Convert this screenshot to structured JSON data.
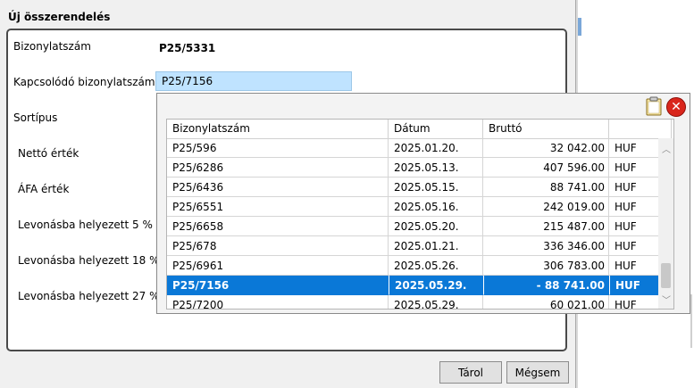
{
  "window": {
    "title": "Új összerendelés"
  },
  "form": {
    "doc_number_label": "Bizonylatszám",
    "doc_number_value": "P25/5331",
    "related_doc_label": "Kapcsolódó bizonylatszám",
    "related_doc_value": "P25/7156",
    "sort_type_label": "Sortípus",
    "net_value_label": "Nettó érték",
    "vat_value_label": "ÁFA érték",
    "deducted_5_label": "Levonásba helyezett 5 %",
    "deducted_18_label": "Levonásba helyezett 18 %",
    "deducted_27_label": "Levonásba helyezett 27 %"
  },
  "buttons": {
    "save": "Tárol",
    "cancel": "Mégsem"
  },
  "popup": {
    "icons": [
      "clipboard-icon",
      "close-icon"
    ],
    "columns": [
      "Bizonylatszám",
      "Dátum",
      "Bruttó",
      ""
    ],
    "rows": [
      {
        "doc": "P25/596",
        "date": "2025.01.20.",
        "gross": "32 042.00",
        "cur": "HUF",
        "selected": false
      },
      {
        "doc": "P25/6286",
        "date": "2025.05.13.",
        "gross": "407 596.00",
        "cur": "HUF",
        "selected": false
      },
      {
        "doc": "P25/6436",
        "date": "2025.05.15.",
        "gross": "88 741.00",
        "cur": "HUF",
        "selected": false
      },
      {
        "doc": "P25/6551",
        "date": "2025.05.16.",
        "gross": "242 019.00",
        "cur": "HUF",
        "selected": false
      },
      {
        "doc": "P25/6658",
        "date": "2025.05.20.",
        "gross": "215 487.00",
        "cur": "HUF",
        "selected": false
      },
      {
        "doc": "P25/678",
        "date": "2025.01.21.",
        "gross": "336 346.00",
        "cur": "HUF",
        "selected": false
      },
      {
        "doc": "P25/6961",
        "date": "2025.05.26.",
        "gross": "306 783.00",
        "cur": "HUF",
        "selected": false
      },
      {
        "doc": "P25/7156",
        "date": "2025.05.29.",
        "gross": "-  88 741.00",
        "cur": "HUF",
        "selected": true
      },
      {
        "doc": "P25/7200",
        "date": "2025.05.29.",
        "gross": "60 021.00",
        "cur": "HUF",
        "selected": false
      }
    ]
  },
  "colors": {
    "selection": "#0a78d7",
    "input_bg": "#bfe3ff"
  }
}
